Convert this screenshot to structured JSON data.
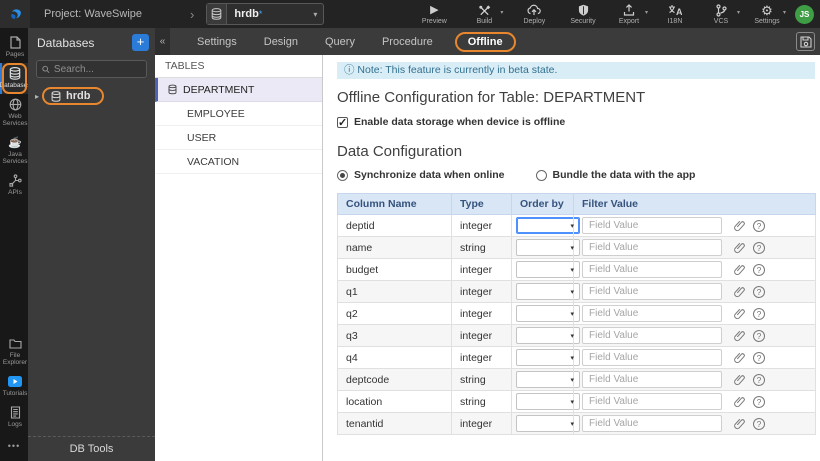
{
  "colors": {
    "accent_orange": "#e8872e",
    "accent_blue": "#2f7bd8",
    "avatar_green": "#3f9d46",
    "note_bg": "#d9edf7",
    "note_text": "#31708f",
    "table_header_bg": "#d8e6f6",
    "selected_table_row_bg": "#eae9f5"
  },
  "icons": {
    "caret_down": "▾",
    "play": "▶",
    "gear": "⚙",
    "coffee": "☕",
    "info": "ⓘ",
    "collapse": "«",
    "tree_expand": "▸",
    "breadcrumb_chevron": "›",
    "more": "•••",
    "plus": "+"
  },
  "topbar": {
    "project_label": "Project: WaveSwipe",
    "db_selector": {
      "value": "hrdb",
      "dirty_marker": "*"
    },
    "actions_left": [
      {
        "label": "Preview",
        "icon": "preview-play-icon",
        "dropdown": false
      },
      {
        "label": "Build",
        "icon": "build-tools-icon",
        "dropdown": true
      },
      {
        "label": "Deploy",
        "icon": "deploy-cloud-icon",
        "dropdown": false
      }
    ],
    "actions_right": [
      {
        "label": "Security",
        "icon": "shield-icon",
        "dropdown": false
      },
      {
        "label": "Export",
        "icon": "export-icon",
        "dropdown": true
      },
      {
        "label": "I18N",
        "icon": "i18n-icon",
        "dropdown": false
      },
      {
        "label": "VCS",
        "icon": "branch-icon",
        "dropdown": true
      },
      {
        "label": "Settings",
        "icon": "gear-icon",
        "dropdown": true
      }
    ],
    "avatar_initials": "JS"
  },
  "left_rail": {
    "items": [
      {
        "label": "Pages",
        "icon": "page-icon",
        "selected": false
      },
      {
        "label": "Databases",
        "icon": "database-icon",
        "selected": true
      },
      {
        "label": "Web Services",
        "icon": "globe-icon",
        "selected": false
      },
      {
        "label": "Java Services",
        "icon": "coffee-icon",
        "selected": false
      },
      {
        "label": "APIs",
        "icon": "api-icon",
        "selected": false
      }
    ],
    "bottom_items": [
      {
        "label": "File Explorer",
        "icon": "folder-icon"
      },
      {
        "label": "Tutorials",
        "icon": "video-play-icon"
      },
      {
        "label": "Logs",
        "icon": "logs-icon"
      }
    ]
  },
  "db_panel": {
    "title": "Databases",
    "search_placeholder": "Search...",
    "items": [
      {
        "label": "hrdb"
      }
    ],
    "footer": "DB Tools"
  },
  "tabs": [
    "Settings",
    "Design",
    "Query",
    "Procedure",
    "Offline"
  ],
  "active_tab": "Offline",
  "tables_panel": {
    "title": "TABLES",
    "items": [
      "DEPARTMENT",
      "EMPLOYEE",
      "USER",
      "VACATION"
    ],
    "selected": "DEPARTMENT"
  },
  "main": {
    "note": "Note: This feature is currently in beta state.",
    "title": "Offline Configuration for Table: DEPARTMENT",
    "enable_checkbox": {
      "label": "Enable data storage when device is offline",
      "checked": true
    },
    "section_title": "Data Configuration",
    "radio_options": [
      {
        "label": "Synchronize data when online",
        "selected": true
      },
      {
        "label": "Bundle the data with the app",
        "selected": false
      }
    ],
    "table": {
      "headers": [
        "Column Name",
        "Type",
        "Order by",
        "Filter Value"
      ],
      "filter_placeholder": "Field Value",
      "order_by_selected_value": "",
      "rows": [
        {
          "name": "deptid",
          "type": "integer"
        },
        {
          "name": "name",
          "type": "string"
        },
        {
          "name": "budget",
          "type": "integer"
        },
        {
          "name": "q1",
          "type": "integer"
        },
        {
          "name": "q2",
          "type": "integer"
        },
        {
          "name": "q3",
          "type": "integer"
        },
        {
          "name": "q4",
          "type": "integer"
        },
        {
          "name": "deptcode",
          "type": "string"
        },
        {
          "name": "location",
          "type": "string"
        },
        {
          "name": "tenantid",
          "type": "integer"
        }
      ]
    }
  }
}
